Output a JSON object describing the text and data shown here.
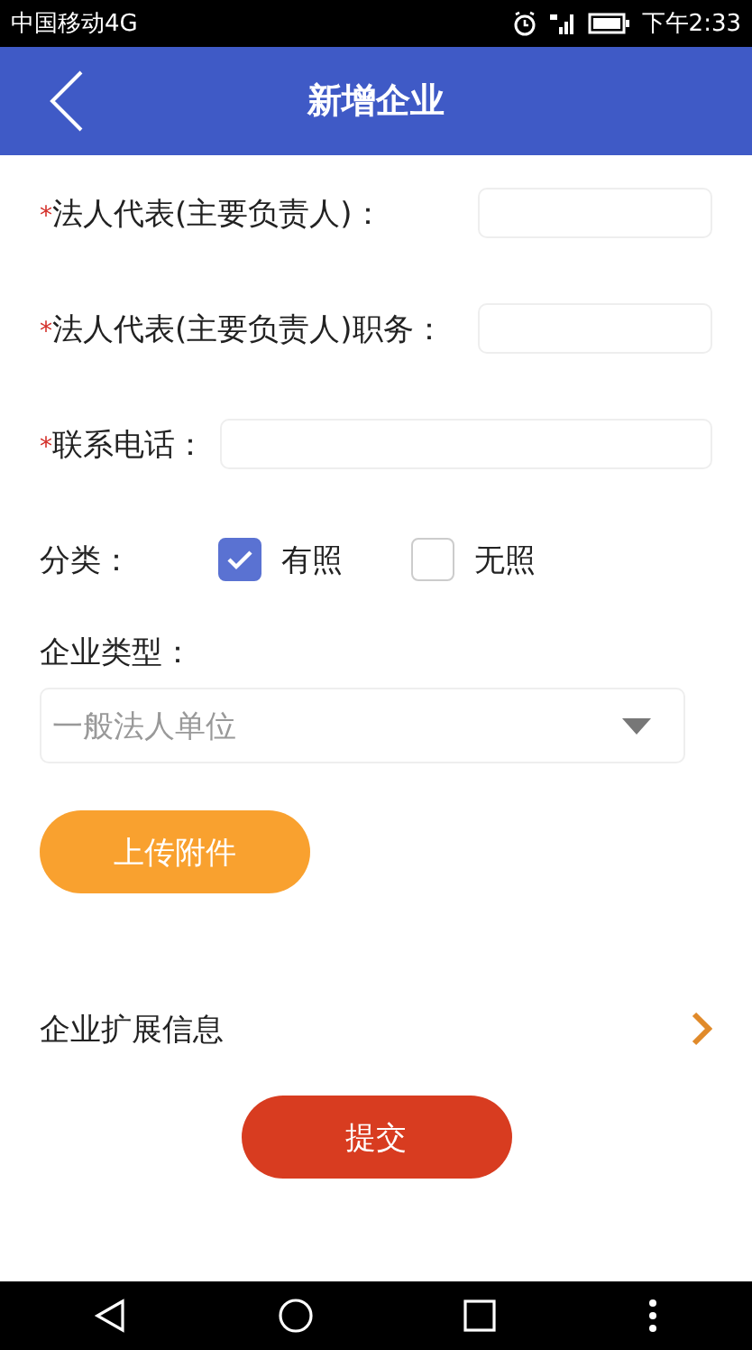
{
  "status_bar": {
    "carrier": "中国移动4G",
    "time": "下午2:33"
  },
  "header": {
    "title": "新增企业"
  },
  "fields": [
    {
      "mark": "*",
      "label": "法人代表(主要负责人)：",
      "kind": "short"
    },
    {
      "mark": "*",
      "label": "法人代表(主要负责人)职务：",
      "kind": "short"
    },
    {
      "mark": "*",
      "label": "联系电话：",
      "kind": "wide"
    }
  ],
  "classification": {
    "label": "分类：",
    "options": [
      {
        "label": "有照",
        "checked": true
      },
      {
        "label": "无照",
        "checked": false
      }
    ]
  },
  "company_type": {
    "label": "企业类型：",
    "value": "一般法人单位"
  },
  "upload_button": "上传附件",
  "extension_link": "企业扩展信息",
  "submit_button": "提交"
}
